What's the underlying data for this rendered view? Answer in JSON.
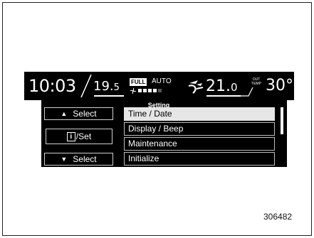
{
  "status_bar": {
    "clock": "10:03",
    "temp_left_whole": "19.",
    "temp_left_decimal": "5",
    "full_badge": "FULL",
    "auto_label": "AUTO",
    "temp_right_whole": "21.",
    "temp_right_decimal": "0",
    "out_temp_badge_line1": "OUT",
    "out_temp_badge_line2": "TEMP",
    "out_temp_value": "30°C",
    "fan_level_filled": 4,
    "fan_level_total": 5
  },
  "menu": {
    "title": "Setting",
    "buttons": {
      "up_label": "Select",
      "set_info_glyph": "i",
      "set_label": "/Set",
      "down_label": "Select"
    },
    "items": [
      {
        "label": "Time / Date",
        "selected": true
      },
      {
        "label": "Display / Beep",
        "selected": false
      },
      {
        "label": "Maintenance",
        "selected": false
      },
      {
        "label": "Initialize",
        "selected": false
      }
    ]
  },
  "figure_number": "306482",
  "colors": {
    "background": "#ffffff",
    "screen": "#000000",
    "text": "#ffffff",
    "selected_row": "#e6e6e6"
  }
}
